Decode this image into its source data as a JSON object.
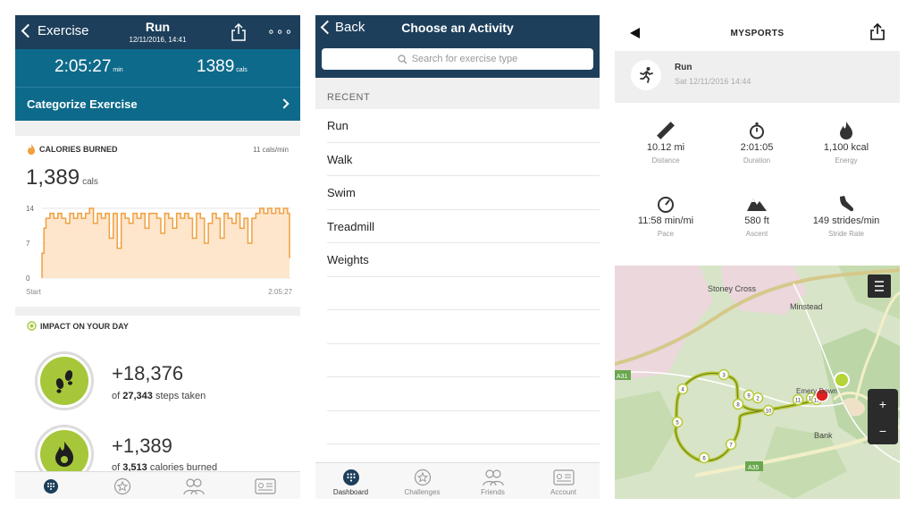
{
  "fitbit": {
    "nav": {
      "back_label": "Exercise",
      "title": "Run",
      "datetime": "12/11/2016, 14:41"
    },
    "duration": "2:05:27",
    "duration_unit": "min",
    "calories": "1389",
    "calories_unit": "cals",
    "categorize_label": "Categorize Exercise",
    "calories_section": {
      "header": "CALORIES BURNED",
      "rate": "11 cals/min",
      "total": "1,389",
      "total_unit": "cals"
    },
    "chart_data": {
      "type": "line",
      "title": "",
      "y_ticks": [
        "14",
        "7",
        "0"
      ],
      "x_labels": [
        "Start",
        "2:05:27"
      ],
      "ylim": [
        0,
        14
      ],
      "xlim": [
        0,
        125.45
      ],
      "x": [
        0,
        1,
        2,
        4,
        6,
        8,
        10,
        12,
        14,
        16,
        18,
        20,
        22,
        24,
        26,
        28,
        30,
        32,
        34,
        36,
        38,
        40,
        42,
        44,
        46,
        48,
        50,
        52,
        54,
        56,
        58,
        60,
        62,
        64,
        66,
        68,
        70,
        72,
        74,
        76,
        78,
        80,
        82,
        84,
        86,
        88,
        90,
        92,
        94,
        96,
        98,
        100,
        102,
        104,
        106,
        108,
        110,
        112,
        114,
        116,
        118,
        120,
        122,
        124,
        125
      ],
      "values": [
        5,
        10,
        12,
        13,
        12,
        13,
        12,
        11,
        13,
        12,
        13,
        12,
        13,
        14,
        11,
        13,
        12,
        13,
        8,
        13,
        6,
        13,
        12,
        11,
        13,
        12,
        13,
        10,
        13,
        13,
        12,
        9,
        13,
        12,
        10,
        13,
        12,
        13,
        12,
        8,
        13,
        12,
        7,
        11,
        13,
        12,
        8,
        13,
        12,
        11,
        13,
        10,
        12,
        7,
        12,
        13,
        14,
        13,
        14,
        13,
        14,
        13,
        14,
        13,
        4
      ],
      "line_color": "#f0a040",
      "fill_color": "#fde6cc"
    },
    "impact": {
      "header": "IMPACT ON YOUR DAY",
      "steps_value": "+18,376",
      "steps_prefix": "of",
      "steps_total": "27,343",
      "steps_suffix": "steps taken",
      "cal_value": "+1,389",
      "cal_prefix": "of",
      "cal_total": "3,513",
      "cal_suffix": "calories burned"
    },
    "accent": "#a6c73a"
  },
  "chooser": {
    "nav": {
      "back_label": "Back",
      "title": "Choose an Activity"
    },
    "search_placeholder": "Search for exercise type",
    "section_label": "RECENT",
    "items": [
      "Run",
      "Walk",
      "Swim",
      "Treadmill",
      "Weights"
    ],
    "tabs": [
      "Dashboard",
      "Challenges",
      "Friends",
      "Account"
    ]
  },
  "mysports": {
    "title": "MYSPORTS",
    "activity_name": "Run",
    "activity_date": "Sat 12/11/2016 14:44",
    "metrics": [
      {
        "icon": "ruler-icon",
        "value": "10.12",
        "unit": "mi",
        "label": "Distance"
      },
      {
        "icon": "stopwatch-icon",
        "value": "2:01:05",
        "unit": "",
        "label": "Duration"
      },
      {
        "icon": "flame-icon",
        "value": "1,100",
        "unit": "kcal",
        "label": "Energy"
      },
      {
        "icon": "speedometer-icon",
        "value": "11:58",
        "unit": "min/mi",
        "label": "Pace"
      },
      {
        "icon": "mountain-icon",
        "value": "580",
        "unit": "ft",
        "label": "Ascent"
      },
      {
        "icon": "shoe-icon",
        "value": "149",
        "unit": "strides/min",
        "label": "Stride Rate"
      }
    ],
    "map": {
      "places": [
        "Stoney Cross",
        "Minstead",
        "Emery Down",
        "Bank"
      ],
      "roads": [
        "A31",
        "A35"
      ],
      "route_markers": [
        "2",
        "3",
        "4",
        "5",
        "6",
        "7",
        "8",
        "9",
        "10",
        "11",
        "12",
        "13"
      ],
      "zoom_in": "+",
      "zoom_out": "−",
      "route_color": "#b5c935"
    }
  }
}
